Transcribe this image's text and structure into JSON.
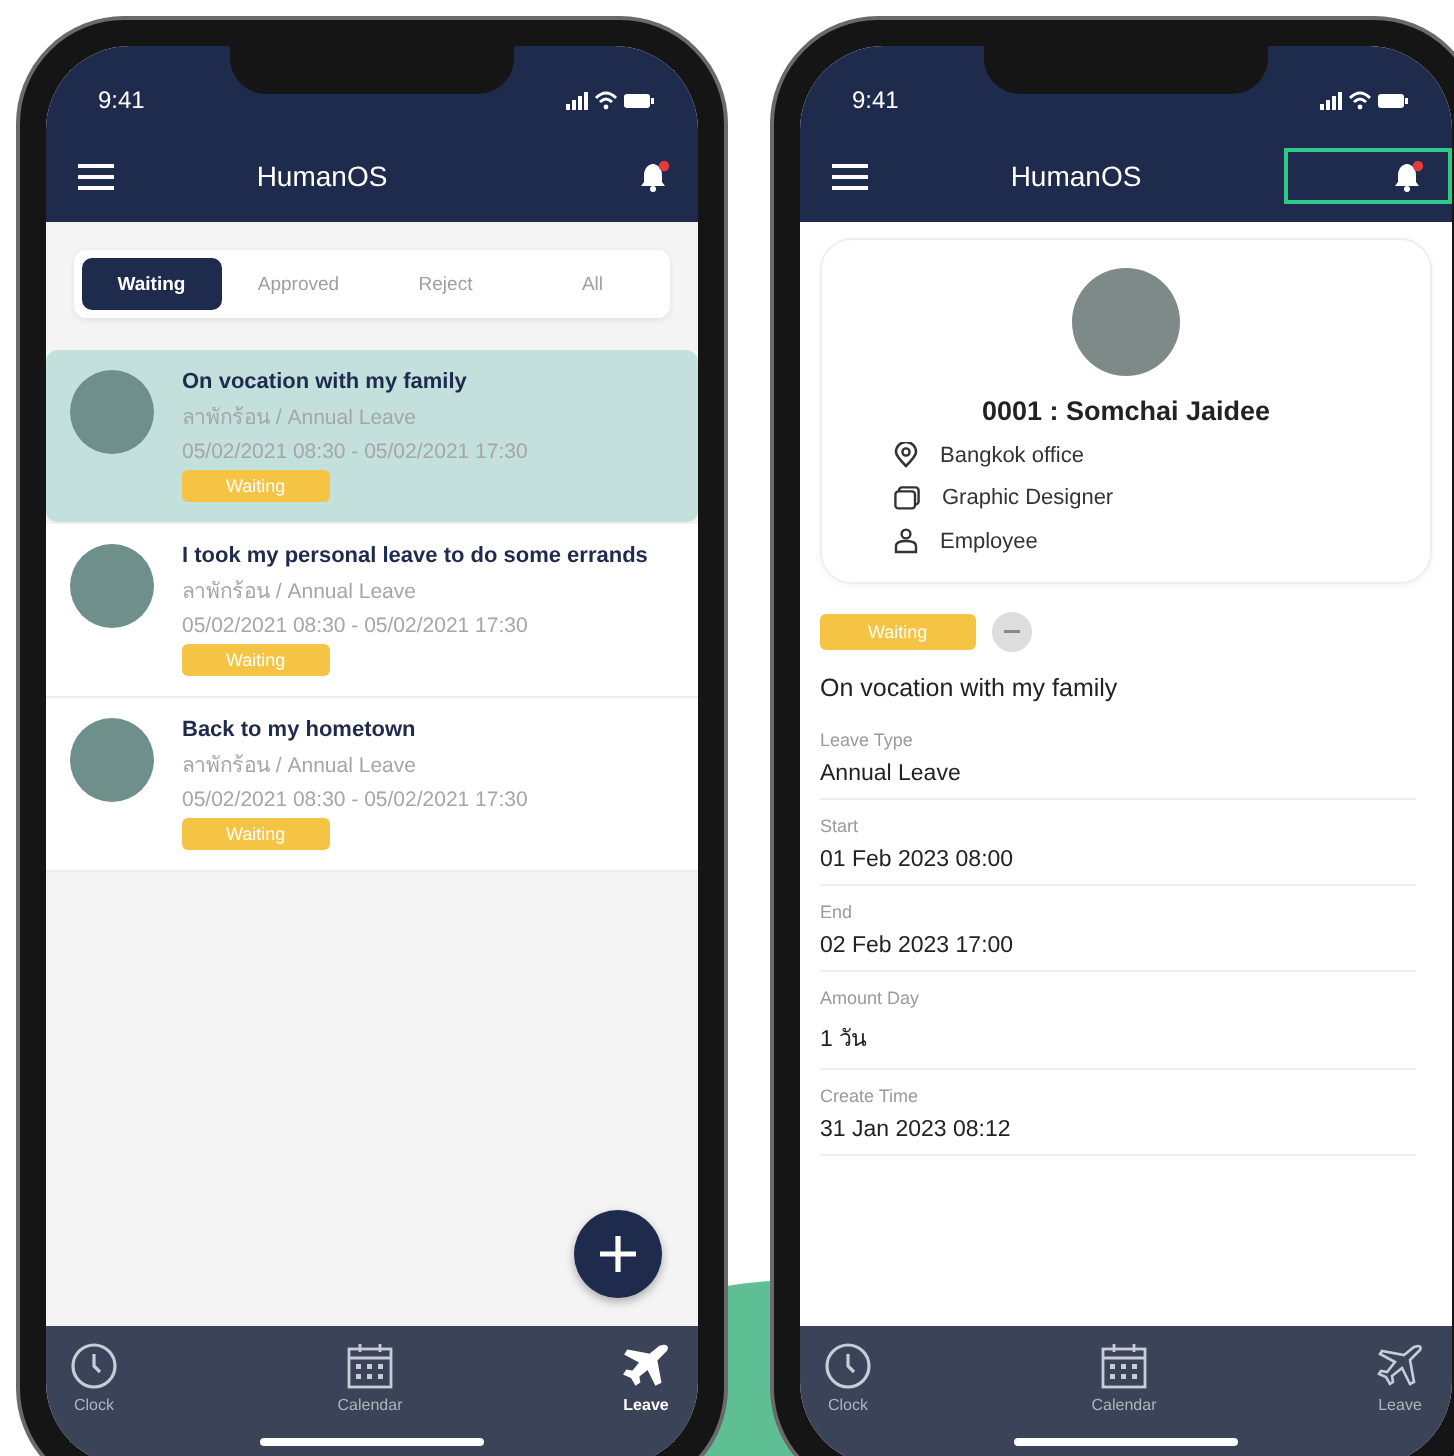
{
  "list_screen": {
    "status_bar": {
      "time": "9:41"
    },
    "app_bar": {
      "title": "HumanOS",
      "notification_highlighted": false
    },
    "tabs": [
      {
        "label": "Waiting",
        "selected": true
      },
      {
        "label": "Approved",
        "selected": false
      },
      {
        "label": "Reject",
        "selected": false
      },
      {
        "label": "All",
        "selected": false
      }
    ],
    "requests": [
      {
        "title": "On vocation with my family",
        "type": "ลาพักร้อน / Annual Leave",
        "period": "05/02/2021 08:30 - 05/02/2021 17:30",
        "status": "Waiting",
        "selected": true
      },
      {
        "title": "I took my personal leave to do some errands",
        "type": "ลาพักร้อน / Annual Leave",
        "period": "05/02/2021 08:30 - 05/02/2021 17:30",
        "status": "Waiting",
        "selected": false
      },
      {
        "title": "Back to my hometown",
        "type": "ลาพักร้อน / Annual Leave",
        "period": "05/02/2021 08:30 - 05/02/2021 17:30",
        "status": "Waiting",
        "selected": false
      }
    ],
    "bottom_nav": [
      {
        "kind": "clock",
        "label": "Clock",
        "selected": false
      },
      {
        "kind": "calendar",
        "label": "Calendar",
        "selected": false
      },
      {
        "kind": "plane",
        "label": "Leave",
        "selected": true
      }
    ]
  },
  "detail_screen": {
    "status_bar": {
      "time": "9:41"
    },
    "app_bar": {
      "title": "HumanOS",
      "notification_highlighted": true
    },
    "profile": {
      "name": "0001 : Somchai Jaidee",
      "info": [
        {
          "kind": "location",
          "text": "Bangkok office"
        },
        {
          "kind": "folder",
          "text": "Graphic Designer"
        },
        {
          "kind": "person",
          "text": "Employee"
        }
      ]
    },
    "status": "Waiting",
    "title": "On vocation with my family",
    "fields": [
      {
        "label": "Leave Type",
        "value": "Annual Leave"
      },
      {
        "label": "Start",
        "value": "01 Feb 2023 08:00"
      },
      {
        "label": "End",
        "value": "02 Feb 2023 17:00"
      },
      {
        "label": "Amount Day",
        "value": "1 วัน"
      },
      {
        "label": "Create Time",
        "value": "31 Jan 2023 08:12"
      }
    ],
    "bottom_nav": [
      {
        "kind": "clock",
        "label": "Clock",
        "selected": false
      },
      {
        "kind": "calendar",
        "label": "Calendar",
        "selected": false
      },
      {
        "kind": "plane",
        "label": "Leave",
        "selected": false
      }
    ]
  }
}
